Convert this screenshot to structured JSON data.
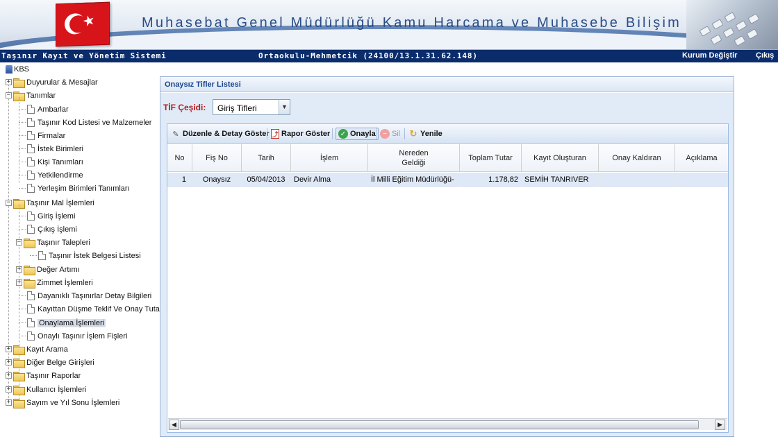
{
  "header": {
    "title": "Muhasebat Genel Müdürlüğü Kamu Harcama ve Muhasebe Bilişim Sistemi"
  },
  "topbar": {
    "system_name": "Taşınır Kayıt ve Yönetim Sistemi",
    "institution": "Ortaokulu-Mehmetcik (24100/13.1.31.62.148)",
    "change_institution": "Kurum Değiştir",
    "exit": "Çıkış"
  },
  "tree": {
    "root": "KBS",
    "items": [
      {
        "label": "Duyurular & Mesajlar"
      },
      {
        "label": "Tanımlar"
      },
      {
        "label": "Ambarlar"
      },
      {
        "label": "Taşınır Kod Listesi ve Malzemeler"
      },
      {
        "label": "Firmalar"
      },
      {
        "label": "İstek Birimleri"
      },
      {
        "label": "Kişi Tanımları"
      },
      {
        "label": "Yetkilendirme"
      },
      {
        "label": "Yerleşim Birimleri Tanımları"
      },
      {
        "label": "Taşınır Mal İşlemleri"
      },
      {
        "label": "Giriş İşlemi"
      },
      {
        "label": "Çıkış İşlemi"
      },
      {
        "label": "Taşınır Talepleri"
      },
      {
        "label": "Taşınır İstek Belgesi Listesi"
      },
      {
        "label": "Değer Artımı"
      },
      {
        "label": "Zimmet İşlemleri"
      },
      {
        "label": "Dayanıklı Taşınırlar Detay Bilgileri"
      },
      {
        "label": "Kayıttan Düşme Teklif Ve Onay Tutanağı"
      },
      {
        "label": "Onaylama İşlemleri"
      },
      {
        "label": "Onaylı Taşınır İşlem Fişleri"
      },
      {
        "label": "Kayıt Arama"
      },
      {
        "label": "Diğer Belge Girişleri"
      },
      {
        "label": "Taşınır Raporlar"
      },
      {
        "label": "Kullanıcı İşlemleri"
      },
      {
        "label": "Sayım ve Yıl Sonu İşlemleri"
      }
    ]
  },
  "panel": {
    "title": "Onaysız Tifler Listesi",
    "tif_label": "TİF Çeşidi:",
    "tif_value": "Giriş Tifleri"
  },
  "toolbar": {
    "edit": "Düzenle & Detay Göster",
    "report": "Rapor Göster",
    "approve": "Onayla",
    "delete": "Sil",
    "refresh": "Yenile"
  },
  "table": {
    "headers": [
      "No",
      "Fiş No",
      "Tarih",
      "İşlem",
      "Nereden Geldiği",
      "Toplam Tutar",
      "Kayıt Oluşturan",
      "Onay Kaldıran",
      "Açıklama"
    ],
    "rows": [
      [
        "1",
        "Onaysız",
        "05/04/2013",
        "Devir Alma",
        "İl Milli Eğitim Müdürlüğü-",
        "1.178,82",
        "SEMİH TANRIVER",
        "",
        ""
      ]
    ]
  },
  "colors": {
    "topbar": "#0b2c6b",
    "title_text": "#2a4d86",
    "panel_title": "#15428b",
    "tif_label": "#b01e1e",
    "row_selected": "#dfe8f6"
  }
}
